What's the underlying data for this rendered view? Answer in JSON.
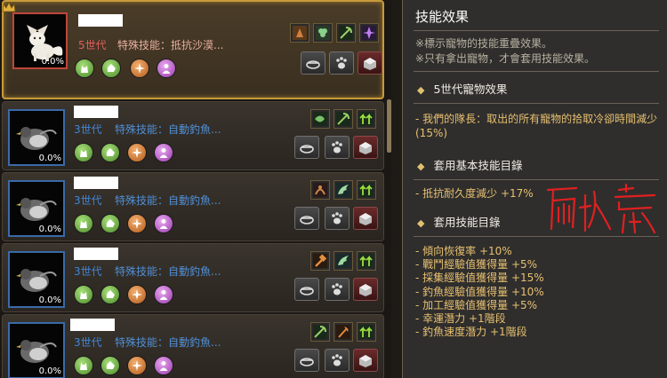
{
  "pets": [
    {
      "generation": "5世代",
      "skill": "特殊技能：抵抗沙漠...",
      "percent": "0.0%",
      "selected": true
    },
    {
      "generation": "3世代",
      "skill": "特殊技能：自動釣魚...",
      "percent": "0.0%",
      "selected": false
    },
    {
      "generation": "3世代",
      "skill": "特殊技能：自動釣魚...",
      "percent": "0.0%",
      "selected": false
    },
    {
      "generation": "3世代",
      "skill": "特殊技能：自動釣魚...",
      "percent": "0.0%",
      "selected": false
    },
    {
      "generation": "3世代",
      "skill": "特殊技能：自動釣魚...",
      "percent": "0.0%",
      "selected": false
    }
  ],
  "tooltip": {
    "title": "技能效果",
    "notes": [
      "※標示寵物的技能重疊效果。",
      "※只有拿出寵物，才會套用技能效果。"
    ],
    "section1_title": "5世代寵物效果",
    "section1_text": "- 我們的隊長：取出的所有寵物的拾取冷卻時間減少(15%)",
    "section2_title": "套用基本技能目錄",
    "section2_text": "- 抵抗耐久度減少 +17%",
    "section3_title": "套用技能目錄",
    "stats": [
      "- 傾向恢復率 +10%",
      "- 戰鬥經驗值獲得量 +5%",
      "- 採集經驗值獲得量 +15%",
      "- 釣魚經驗值獲得量 +10%",
      "- 加工經驗值獲得量 +5%",
      "- 幸運潛力 +1階段",
      "- 釣魚速度潛力 +1階段"
    ],
    "handwriting": "耐久寵"
  },
  "colors": {
    "accent": "#c89a3a",
    "gold_text": "#e8c070",
    "blue_text": "#3f86d8",
    "red_text": "#e06060"
  }
}
